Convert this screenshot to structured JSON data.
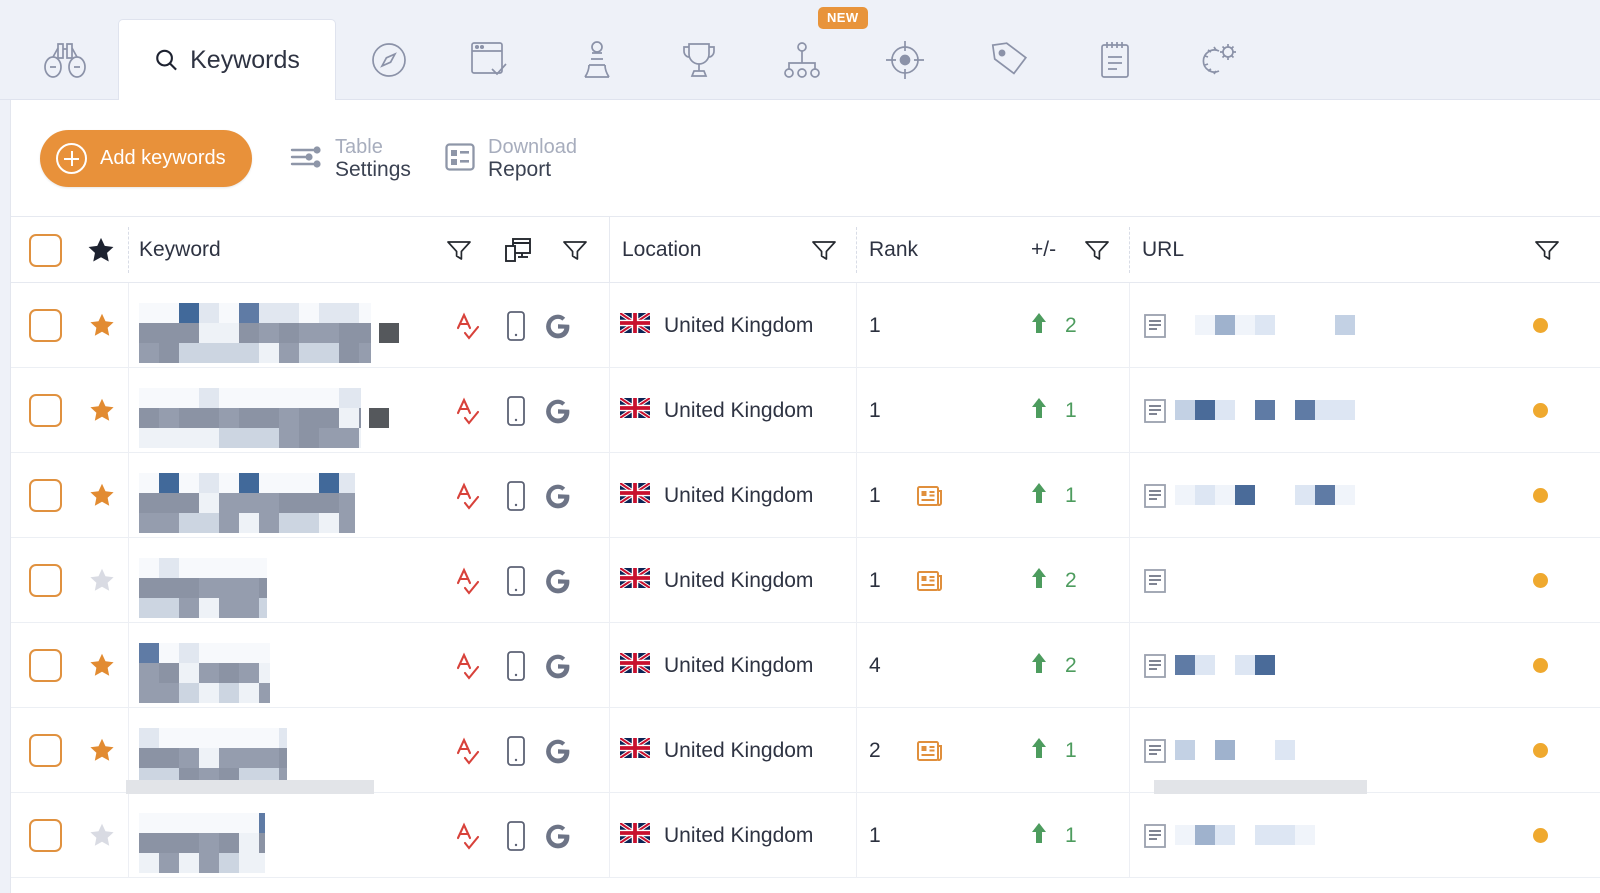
{
  "app": {
    "accent_orange": "#e8913a",
    "badge_new": "NEW",
    "background": "#eef1f8"
  },
  "tabs": {
    "items": [
      {
        "id": "binoculars",
        "icon": "binoculars-icon",
        "label": "",
        "active": false
      },
      {
        "id": "keywords",
        "icon": "magnifier-icon",
        "label": "Keywords",
        "active": true
      },
      {
        "id": "explore",
        "icon": "compass-icon",
        "label": "",
        "active": false
      },
      {
        "id": "pages",
        "icon": "browser-check-icon",
        "label": "",
        "active": false
      },
      {
        "id": "pawn",
        "icon": "chess-pawn-icon",
        "label": "",
        "active": false
      },
      {
        "id": "trophy",
        "icon": "trophy-icon",
        "label": "",
        "active": false
      },
      {
        "id": "sitemap",
        "icon": "sitemap-icon",
        "label": "",
        "active": false,
        "badge": "NEW"
      },
      {
        "id": "target",
        "icon": "crosshair-target-icon",
        "label": "",
        "active": false
      },
      {
        "id": "tags",
        "icon": "tag-icon",
        "label": "",
        "active": false
      },
      {
        "id": "notes",
        "icon": "notepad-icon",
        "label": "",
        "active": false
      },
      {
        "id": "settings",
        "icon": "gears-icon",
        "label": "",
        "active": false
      }
    ]
  },
  "toolbar": {
    "add_keywords_label": "Add keywords",
    "table_settings": {
      "line1": "Table",
      "line2": "Settings",
      "icon": "sliders-icon"
    },
    "download_report": {
      "line1": "Download",
      "line2": "Report",
      "icon": "report-grid-icon"
    }
  },
  "table": {
    "headers": {
      "keyword": "Keyword",
      "location": "Location",
      "rank": "Rank",
      "delta": "+/-",
      "url": "URL"
    },
    "header_icons": [
      "filter-icon",
      "device-desktop-mobile-icon",
      "filter-icon",
      "filter-icon",
      "filter-icon",
      "filter-icon"
    ],
    "select_all_checked": false,
    "star_header_icon": "star-filled-icon",
    "rows": [
      {
        "starred": true,
        "keyword_redacted": true,
        "spellcheck_icon": "spellcheck-icon",
        "device_icon": "mobile-icon",
        "engine_icon": "google-icon",
        "location": "United Kingdom",
        "flag": "uk-flag",
        "rank": "1",
        "serp_feature": false,
        "delta_direction": "up",
        "delta": "2",
        "url_redacted": true,
        "status_dot": "#efa92f"
      },
      {
        "starred": true,
        "keyword_redacted": true,
        "spellcheck_icon": "spellcheck-icon",
        "device_icon": "mobile-icon",
        "engine_icon": "google-icon",
        "location": "United Kingdom",
        "flag": "uk-flag",
        "rank": "1",
        "serp_feature": false,
        "delta_direction": "up",
        "delta": "1",
        "url_redacted": true,
        "status_dot": "#efa92f"
      },
      {
        "starred": true,
        "keyword_redacted": true,
        "spellcheck_icon": "spellcheck-icon",
        "device_icon": "mobile-icon",
        "engine_icon": "google-icon",
        "location": "United Kingdom",
        "flag": "uk-flag",
        "rank": "1",
        "serp_feature": true,
        "delta_direction": "up",
        "delta": "1",
        "url_redacted": true,
        "status_dot": "#efa92f"
      },
      {
        "starred": false,
        "keyword_redacted": true,
        "spellcheck_icon": "spellcheck-icon",
        "device_icon": "mobile-icon",
        "engine_icon": "google-icon",
        "location": "United Kingdom",
        "flag": "uk-flag",
        "rank": "1",
        "serp_feature": true,
        "delta_direction": "up",
        "delta": "2",
        "url_redacted": true,
        "status_dot": "#efa92f"
      },
      {
        "starred": true,
        "keyword_redacted": true,
        "spellcheck_icon": "spellcheck-icon",
        "device_icon": "mobile-icon",
        "engine_icon": "google-icon",
        "location": "United Kingdom",
        "flag": "uk-flag",
        "rank": "4",
        "serp_feature": false,
        "delta_direction": "up",
        "delta": "2",
        "url_redacted": true,
        "status_dot": "#efa92f"
      },
      {
        "starred": true,
        "keyword_redacted": true,
        "spellcheck_icon": "spellcheck-icon",
        "device_icon": "mobile-icon",
        "engine_icon": "google-icon",
        "location": "United Kingdom",
        "flag": "uk-flag",
        "rank": "2",
        "serp_feature": true,
        "delta_direction": "up",
        "delta": "1",
        "url_redacted": true,
        "status_dot": "#efa92f"
      },
      {
        "starred": false,
        "keyword_redacted": true,
        "spellcheck_icon": "spellcheck-icon",
        "device_icon": "mobile-icon",
        "engine_icon": "google-icon",
        "location": "United Kingdom",
        "flag": "uk-flag",
        "rank": "1",
        "serp_feature": false,
        "delta_direction": "up",
        "delta": "1",
        "url_redacted": true,
        "status_dot": "#efa92f"
      }
    ]
  },
  "scrollbars": {
    "keyword_column": {
      "visible": true
    },
    "url_column": {
      "visible": true
    }
  }
}
